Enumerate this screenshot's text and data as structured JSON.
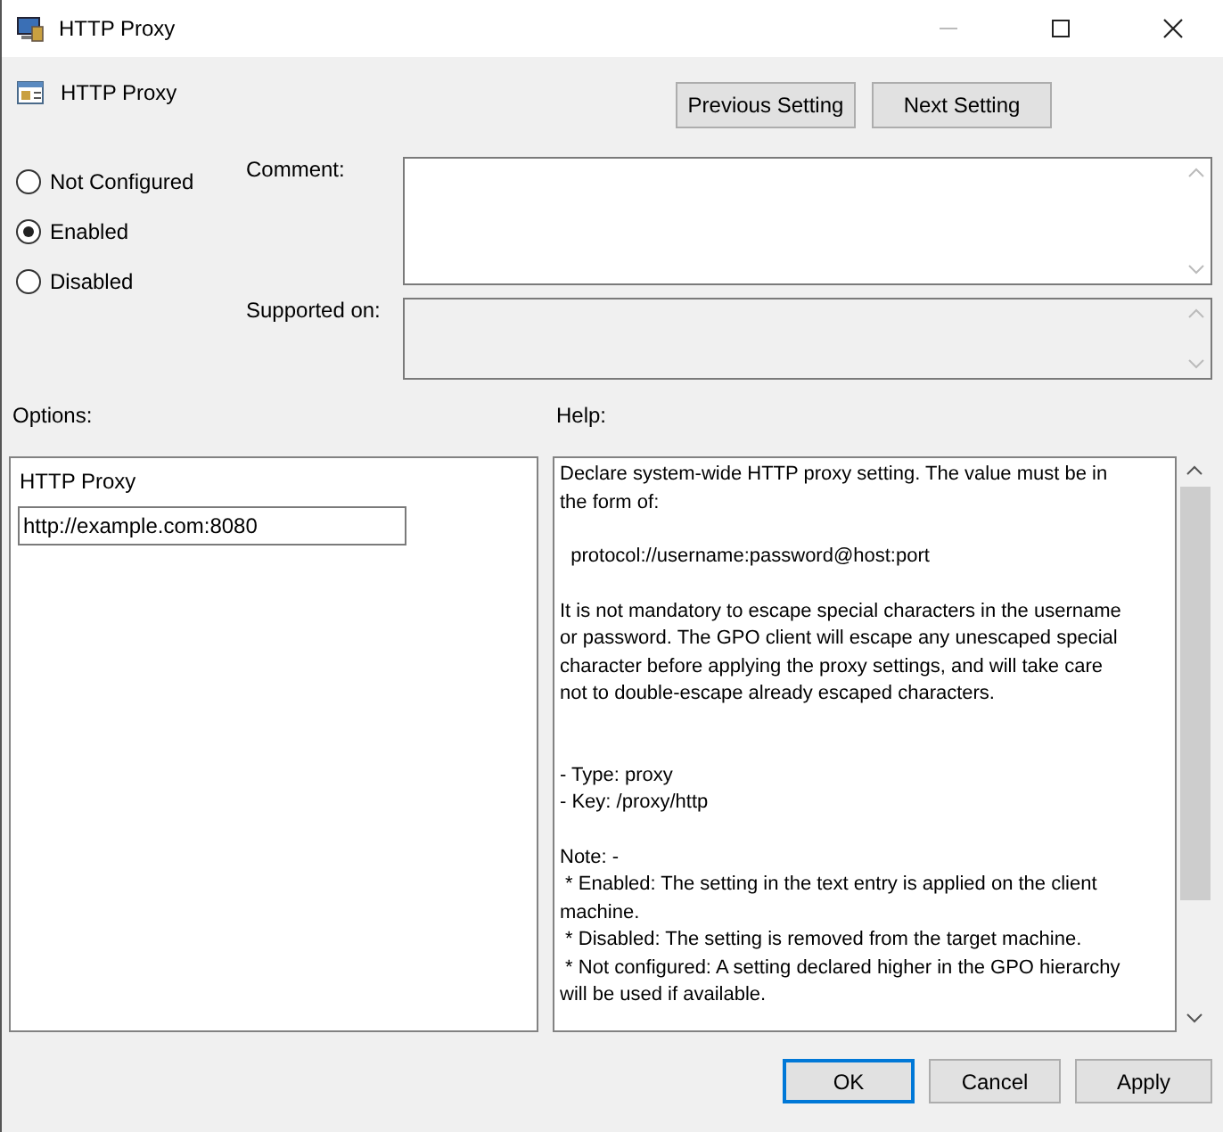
{
  "window": {
    "title": "HTTP Proxy"
  },
  "header": {
    "setting_name": "HTTP Proxy",
    "buttons": [
      "Previous Setting",
      "Next Setting"
    ]
  },
  "state_options": [
    {
      "label": "Not Configured",
      "selected": false
    },
    {
      "label": "Enabled",
      "selected": true
    },
    {
      "label": "Disabled",
      "selected": false
    }
  ],
  "comment": {
    "label": "Comment:"
  },
  "supported_on": {
    "label": "Supported on:"
  },
  "options": {
    "heading": "Options:",
    "field_label": "HTTP Proxy",
    "field_value": "http://example.com:8080"
  },
  "help": {
    "heading": "Help:",
    "paragraphs": [
      {
        "lines": [
          "Declare system-wide HTTP proxy setting. The value must be in",
          "the form of:"
        ]
      },
      {
        "lines": [
          "  protocol://username:password@host:port"
        ]
      },
      {
        "lines": [
          "It is not mandatory to escape special characters in the username",
          "or password. The GPO client will escape any unescaped special",
          "character before applying the proxy settings, and will take care",
          "not to double-escape already escaped characters."
        ]
      },
      {
        "lines": [
          "- Type: proxy",
          "- Key: /proxy/http"
        ]
      },
      {
        "lines": [
          "Note: -",
          " * Enabled: The setting in the text entry is applied on the client",
          "machine.",
          " * Disabled: The setting is removed from the target machine.",
          " * Not configured: A setting declared higher in the GPO hierarchy",
          "will be used if available."
        ]
      }
    ]
  },
  "footer_buttons": [
    {
      "label": "OK",
      "default": true
    },
    {
      "label": "Cancel",
      "default": false
    },
    {
      "label": "Apply",
      "default": false
    }
  ]
}
